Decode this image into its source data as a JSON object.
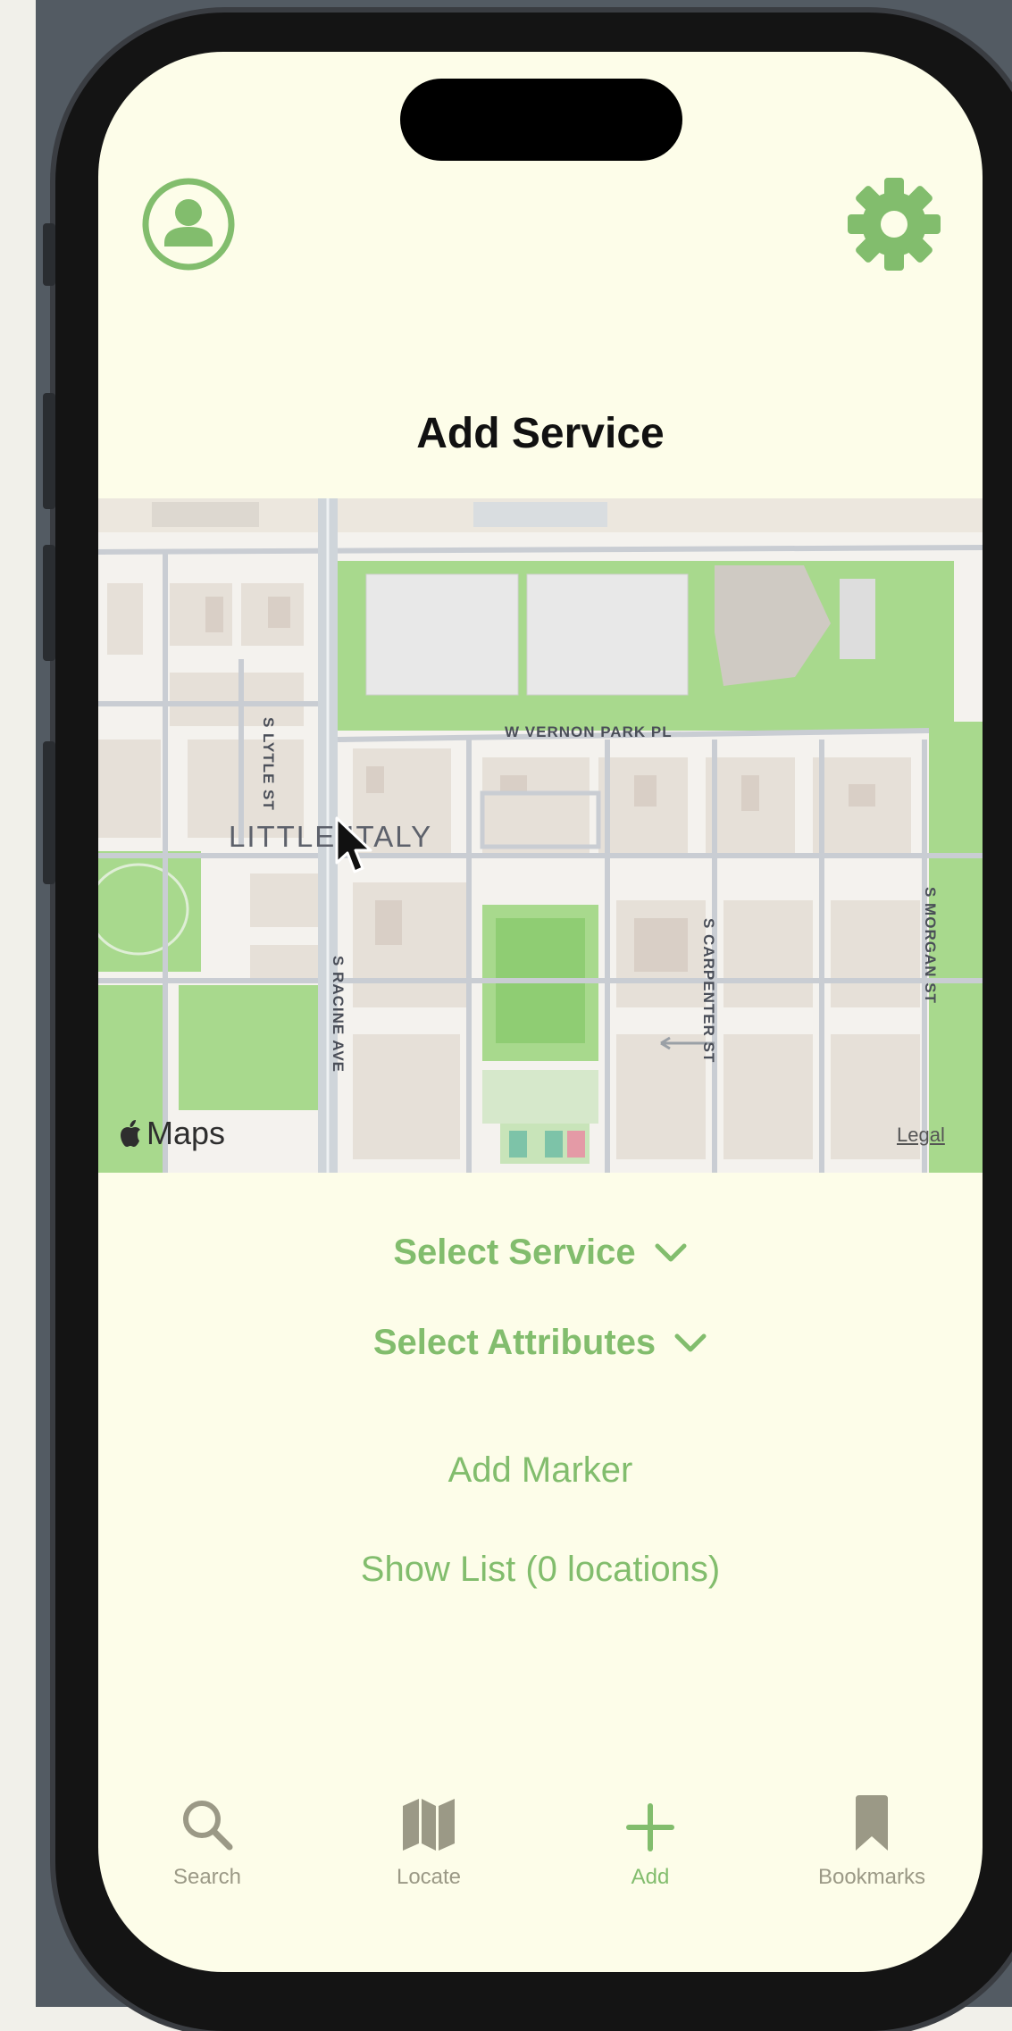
{
  "colors": {
    "accent": "#82bd6d",
    "screen_bg": "#fdfde9",
    "inactive_tab": "#9b9986",
    "park_green": "#a8d98d"
  },
  "header": {
    "profile_icon": "person-circle-icon",
    "settings_icon": "gear-icon",
    "title": "Add Service"
  },
  "map": {
    "district": "LITTLE ITALY",
    "streets": [
      "W VERNON PARK PL",
      "S LYTLE ST",
      "S RACINE AVE",
      "S CARPENTER ST",
      "S MORGAN ST"
    ],
    "brand": "Maps",
    "legal": "Legal"
  },
  "form": {
    "select_service": "Select Service",
    "select_attributes": "Select Attributes",
    "add_marker": "Add Marker",
    "show_list": "Show List (0 locations)"
  },
  "tabbar": {
    "tabs": [
      {
        "label": "Search",
        "icon": "magnifier-icon"
      },
      {
        "label": "Locate",
        "icon": "map-icon"
      },
      {
        "label": "Add",
        "icon": "plus-icon"
      },
      {
        "label": "Bookmarks",
        "icon": "bookmark-icon"
      }
    ],
    "active": "Add"
  }
}
